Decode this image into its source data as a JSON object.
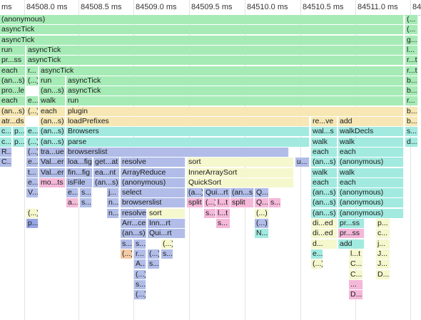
{
  "timeline": {
    "ticks": [
      "ms",
      "84508.0 ms",
      "84508.5 ms",
      "84509.0 ms",
      "84509.5 ms",
      "84510.0 ms",
      "84510.5 ms",
      "84511.0 ms",
      "84"
    ]
  },
  "rows": [
    [
      "(anonymous)",
      "(..."
    ],
    [
      "asyncTick",
      "(..."
    ],
    [
      "asyncTick",
      "g..."
    ],
    [
      "run",
      "asyncTick",
      "l..."
    ],
    [
      "pr...ss",
      "asyncTick",
      "r...t"
    ],
    [
      "each",
      "r...",
      "asyncTick",
      "r...t"
    ],
    [
      "(an...s)",
      "(...)",
      "run",
      "asyncTick",
      "b..."
    ],
    [
      "pro...le",
      "(an...s)",
      "asyncTick",
      "b..."
    ],
    [
      "each",
      "e...",
      "walk",
      "run",
      "r..."
    ],
    [
      "(an...s)",
      "(...)",
      "each",
      "plugin",
      "b..."
    ],
    [
      "atr...ds",
      "(an...s)",
      "loadPrefixes",
      "re...ve",
      "add",
      "b..."
    ],
    [
      "c...",
      "p...",
      "e...",
      "(an...s)",
      "Browsers",
      "wal...s",
      "walkDecls",
      "s..."
    ],
    [
      "c...",
      "p...",
      "(...)",
      "(an...s)",
      "parse",
      "walk",
      "walk",
      "d..."
    ],
    [
      "R...",
      "(...)",
      "tra...ue",
      "browserslist",
      "each",
      "each"
    ],
    [
      "C...",
      "e...",
      "Val...er",
      "loa...fig",
      "get...at",
      "resolve",
      "sort",
      "u...",
      "(an...s)",
      "(anonymous)"
    ],
    [
      "t...",
      "Val...er",
      "fin...fig",
      "ea...nt",
      "ArrayReduce",
      "InnerArraySort",
      "walk",
      "walk"
    ],
    [
      "e...",
      "mo...ts",
      "isFile",
      "(an...s)",
      "(anonymous)",
      "QuickSort",
      "each",
      "each"
    ],
    [
      "V...",
      "e...",
      "s...",
      "j...",
      "select",
      "(a...)",
      "Qui...rt",
      "(an...s)",
      "Q...",
      "(an...s)",
      "(anonymous)"
    ],
    [
      "a...",
      "s...",
      "n...",
      "browserslist",
      "split",
      "(...)",
      "l...t",
      "split",
      "Q...",
      "s...",
      "(an...s)",
      "(anonymous)"
    ],
    [
      "(...)",
      "n...",
      "resolve",
      "sort",
      "s...",
      "(...)",
      "l...t",
      "(an...s)",
      "(anonymous)"
    ],
    [
      "p...",
      "Arr...ce",
      "Inn...rt",
      "s...",
      "(...)",
      "di...ed",
      "pr...ss",
      "p..."
    ],
    [
      "(an...s)",
      "Qui...rt",
      "N...",
      "di...ed",
      "pr...ss",
      "c..."
    ],
    [
      "s...",
      "s...",
      "(...)",
      "d...",
      "add",
      "j..."
    ],
    [
      "(...)",
      "r...",
      "(...)",
      "s...",
      "e...",
      "l...t",
      "J..."
    ],
    [
      "A...",
      "s...",
      "(...)",
      "C...",
      "J..."
    ],
    [
      "(...)",
      "C...",
      "D..."
    ],
    [
      "s...",
      "..."
    ],
    [
      "(...)",
      "D..."
    ]
  ]
}
